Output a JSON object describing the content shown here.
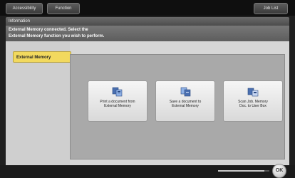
{
  "tabs": [
    {
      "label": "Accessibility"
    },
    {
      "label": "Function"
    }
  ],
  "top_right": {
    "label": "Job List"
  },
  "info": {
    "title": "Information",
    "message_line1": "External Memory connected. Select the",
    "message_line2": "External Memory function you wish to perform."
  },
  "left_panel": {
    "selected_item": "External Memory"
  },
  "actions": [
    {
      "label_line1": "Print a document from",
      "label_line2": "External Memory"
    },
    {
      "label_line1": "Save a document to",
      "label_line2": "External Memory"
    },
    {
      "label_line1": "Scan Job. Memory",
      "label_line2": "Doc. to User Box"
    }
  ],
  "status": {
    "progress": 0.9
  },
  "round_button": {
    "label": "OK"
  },
  "colors": {
    "accent_yellow": "#f2d95e",
    "panel_gray": "#a9a9a9",
    "bezel": "#1f1f1f"
  }
}
